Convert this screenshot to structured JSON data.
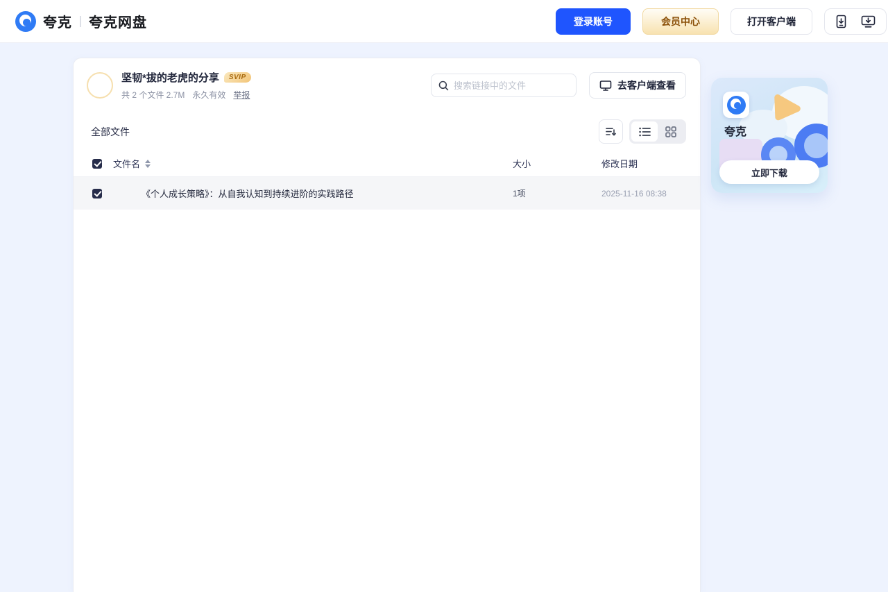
{
  "header": {
    "brand": {
      "name": "夸克",
      "product": "夸克网盘"
    },
    "login_button": "登录账号",
    "vip_button": "会员中心",
    "open_client_button": "打开客户端"
  },
  "share": {
    "title": "坚韧*拔的老虎的分享",
    "badge": "SVIP",
    "files_info": "共 2 个文件 2.7M",
    "validity": "永久有效",
    "report_link": "举报",
    "search_placeholder": "搜索链接中的文件",
    "view_in_client_button": "去客户端查看"
  },
  "filelist": {
    "section_title": "全部文件",
    "columns": {
      "name": "文件名",
      "size": "大小",
      "date": "修改日期"
    },
    "rows": [
      {
        "name": "《个人成长策略》：从自我认知到持续进阶的实践路径",
        "size": "1项",
        "date": "2025-11-16 08:38",
        "checked": true
      }
    ]
  },
  "promo": {
    "app_name": "夸克",
    "download_button": "立即下载"
  },
  "colors": {
    "accent_blue": "#1F55FE",
    "logo_blue": "#2F7BF5",
    "vip_gold_text": "#8A4F07",
    "page_background": "#EEF3FE",
    "selected_row": "#F5F6F8"
  }
}
